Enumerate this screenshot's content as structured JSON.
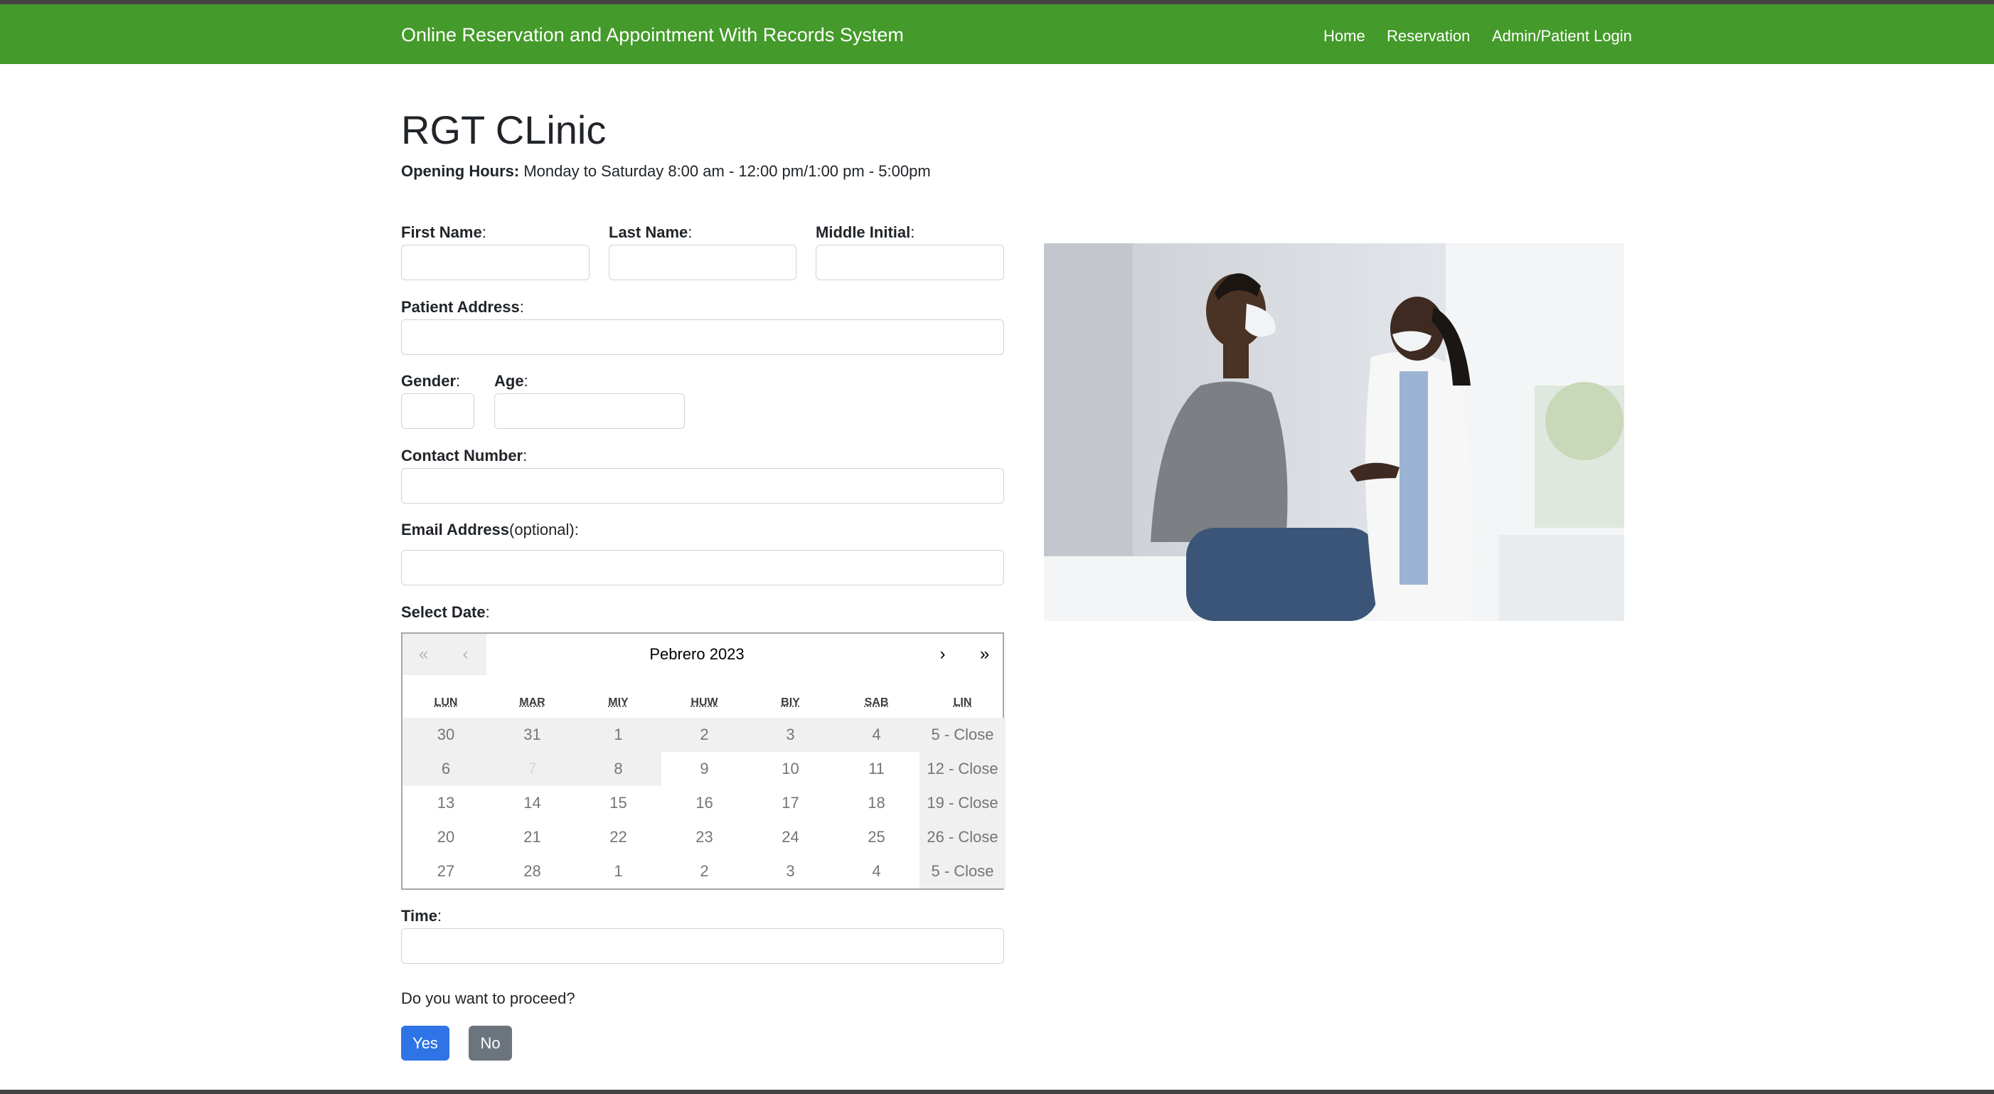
{
  "navbar": {
    "brand": "Online Reservation and Appointment With Records System",
    "links": [
      "Home",
      "Reservation",
      "Admin/Patient Login"
    ],
    "color": "#449a2a"
  },
  "clinic": {
    "title": "RGT CLinic",
    "hours_label": "Opening Hours:",
    "hours_text": " Monday to Saturday 8:00 am - 12:00 pm/1:00 pm - 5:00pm"
  },
  "form": {
    "first_name": {
      "label": "First Name",
      "value": ""
    },
    "last_name": {
      "label": "Last Name",
      "value": ""
    },
    "middle_initial": {
      "label": "Middle Initial",
      "value": ""
    },
    "address": {
      "label": "Patient Address",
      "value": ""
    },
    "gender": {
      "label": "Gender",
      "value": ""
    },
    "age": {
      "label": "Age",
      "value": ""
    },
    "contact": {
      "label": "Contact Number",
      "value": ""
    },
    "email": {
      "label": "Email Address",
      "suffix": "(optional):",
      "value": ""
    },
    "date": {
      "label": "Select Date"
    },
    "time": {
      "label": "Time",
      "value": ""
    },
    "colon": ":"
  },
  "calendar": {
    "title": "Pebrero 2023",
    "nav": {
      "prev_year": "«",
      "prev_month": "‹",
      "next_month": "›",
      "next_year": "»"
    },
    "weekdays": [
      "LUN",
      "MAR",
      "MIY",
      "HUW",
      "BIY",
      "SAB",
      "LIN"
    ],
    "weeks": [
      [
        "30",
        "31",
        "1",
        "2",
        "3",
        "4",
        "5 - Close"
      ],
      [
        "6",
        "7",
        "8",
        "9",
        "10",
        "11",
        "12 - Close"
      ],
      [
        "13",
        "14",
        "15",
        "16",
        "17",
        "18",
        "19 - Close"
      ],
      [
        "20",
        "21",
        "22",
        "23",
        "24",
        "25",
        "26 - Close"
      ],
      [
        "27",
        "28",
        "1",
        "2",
        "3",
        "4",
        "5 - Close"
      ]
    ]
  },
  "confirm": {
    "question": "Do you want to proceed?",
    "yes": "Yes",
    "no": "No",
    "yes_color": "#2f74e7",
    "no_color": "#6c757d"
  },
  "image": {
    "icon": "doctor-patient-photo"
  }
}
